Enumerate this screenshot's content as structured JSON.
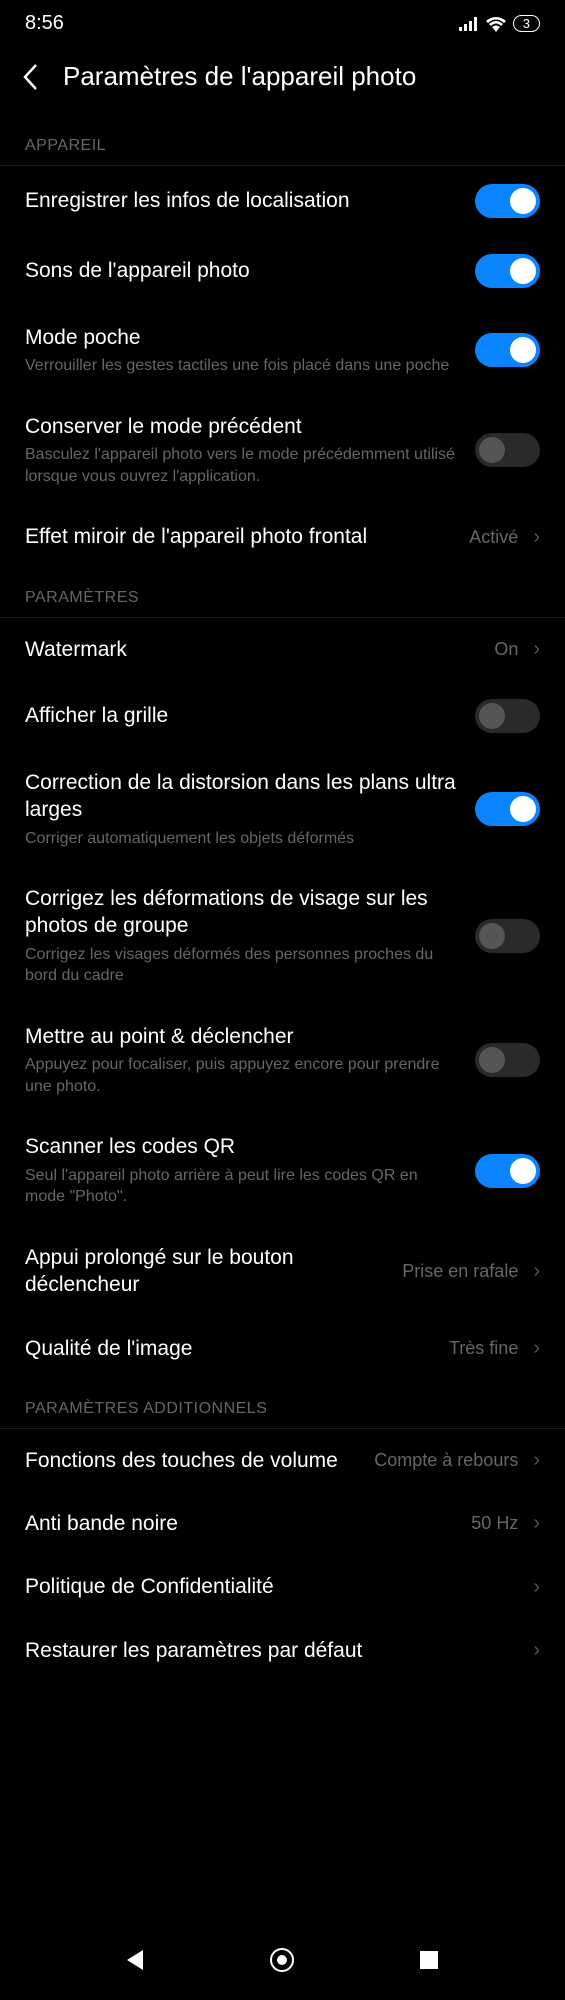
{
  "status": {
    "time": "8:56",
    "battery": "3"
  },
  "header": {
    "title": "Paramètres de l'appareil photo"
  },
  "sections": {
    "appareil": {
      "label": "APPAREIL",
      "location": {
        "title": "Enregistrer les infos de localisation"
      },
      "sounds": {
        "title": "Sons de l'appareil photo"
      },
      "pocket": {
        "title": "Mode poche",
        "sub": "Verrouiller les gestes tactiles une fois placé dans une poche"
      },
      "preserve": {
        "title": "Conserver le mode précédent",
        "sub": "Basculez l'appareil photo vers le mode précédemment utilisé lorsque vous ouvrez l'application."
      },
      "mirror": {
        "title": "Effet miroir de l'appareil photo frontal",
        "value": "Activé"
      }
    },
    "parametres": {
      "label": "PARAMÈTRES",
      "watermark": {
        "title": "Watermark",
        "value": "On"
      },
      "grid": {
        "title": "Afficher la grille"
      },
      "distortion": {
        "title": "Correction de la distorsion dans les plans ultra larges",
        "sub": "Corriger automatiquement les objets déformés"
      },
      "face": {
        "title": "Corrigez les déformations de visage sur les photos de groupe",
        "sub": "Corrigez les visages déformés des personnes proches du bord du cadre"
      },
      "focus": {
        "title": "Mettre au point & déclencher",
        "sub": "Appuyez pour focaliser, puis appuyez encore pour prendre une photo."
      },
      "qr": {
        "title": "Scanner les codes QR",
        "sub": "Seul l'appareil photo arrière à peut lire les codes QR en mode \"Photo\"."
      },
      "shutter": {
        "title": "Appui prolongé sur le bouton déclencheur",
        "value": "Prise en rafale"
      },
      "quality": {
        "title": "Qualité de l'image",
        "value": "Très fine"
      }
    },
    "additional": {
      "label": "PARAMÈTRES ADDITIONNELS",
      "volume": {
        "title": "Fonctions des touches de volume",
        "value": "Compte à rebours"
      },
      "antiband": {
        "title": "Anti bande noire",
        "value": "50 Hz"
      },
      "privacy": {
        "title": "Politique de Confidentialité"
      },
      "restore": {
        "title": "Restaurer les paramètres par défaut"
      }
    }
  }
}
